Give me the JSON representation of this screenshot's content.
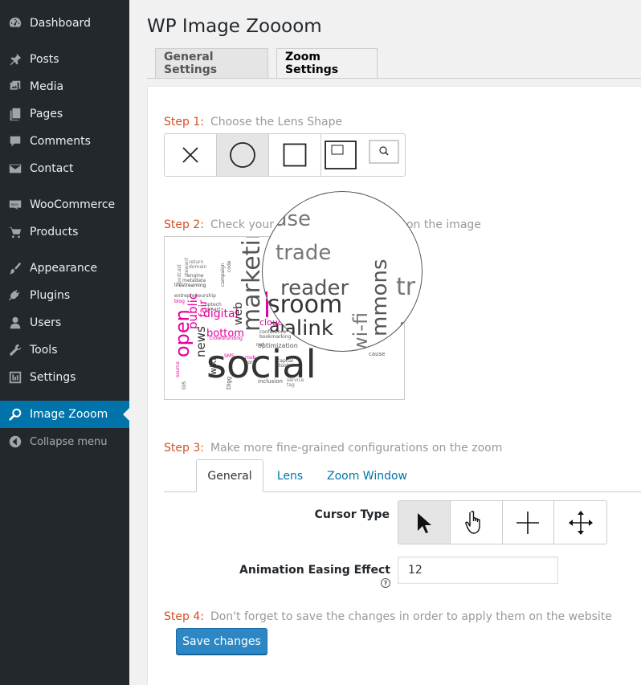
{
  "sidebar": {
    "items": [
      {
        "label": "Dashboard",
        "icon": "dashboard-icon"
      },
      {
        "label": "Posts",
        "icon": "pin-icon"
      },
      {
        "label": "Media",
        "icon": "media-icon"
      },
      {
        "label": "Pages",
        "icon": "pages-icon"
      },
      {
        "label": "Comments",
        "icon": "comment-icon"
      },
      {
        "label": "Contact",
        "icon": "envelope-icon"
      },
      {
        "label": "WooCommerce",
        "icon": "woo-icon"
      },
      {
        "label": "Products",
        "icon": "cart-icon"
      },
      {
        "label": "Appearance",
        "icon": "brush-icon"
      },
      {
        "label": "Plugins",
        "icon": "plug-icon"
      },
      {
        "label": "Users",
        "icon": "user-icon"
      },
      {
        "label": "Tools",
        "icon": "wrench-icon"
      },
      {
        "label": "Settings",
        "icon": "sliders-icon"
      },
      {
        "label": "Image Zooom",
        "icon": "magnifier-icon"
      }
    ],
    "collapse_label": "Collapse menu",
    "active_color": "#0073aa",
    "background": "#23282d"
  },
  "page": {
    "title": "WP Image Zoooom",
    "tabs": [
      {
        "label": "General Settings",
        "active": false
      },
      {
        "label": "Zoom Settings",
        "active": true
      }
    ]
  },
  "steps": {
    "step1": {
      "num": "Step 1:",
      "text": "Choose the Lens Shape"
    },
    "step2": {
      "num": "Step 2:",
      "text": "Check your configuration changes on the image"
    },
    "step3": {
      "num": "Step 3:",
      "text": "Make more fine-grained configurations on the zoom"
    },
    "step4": {
      "num": "Step 4:",
      "text": "Don't forget to save the changes in order to apply them on the website"
    }
  },
  "lens_shapes": [
    "none-icon",
    "circle-icon",
    "square-icon",
    "square-window-icon"
  ],
  "lens_shape_selected": 1,
  "demo": {
    "words": [
      "social",
      "marketing",
      "open",
      "newsroom",
      "alink",
      "trade",
      "reader",
      "commons",
      "wi-fi",
      "digital",
      "bottom",
      "public",
      "fair",
      "news",
      "web",
      "cloud",
      "wiki",
      "Digg",
      "optimization",
      "inclusion",
      "entrepreneurship",
      "lifestreaming",
      "engine",
      "metadata",
      "return",
      "domain",
      "podcast",
      "steward",
      "campaign",
      "code",
      "crowdfunding",
      "smart",
      "nptech",
      "service",
      "tag",
      "tools",
      "capital",
      "corp",
      "cause",
      "mob",
      "SMS",
      "conference",
      "bookmarking",
      "net",
      "blog",
      "source",
      "GIS"
    ],
    "lens_words": [
      "use",
      "trade",
      "reader",
      "sroom",
      "alink",
      "mmons",
      "wi-fi",
      "tr",
      "gs"
    ]
  },
  "subtabs": [
    "General",
    "Lens",
    "Zoom Window"
  ],
  "fields": {
    "cursor_type_label": "Cursor Type",
    "cursor_types": [
      "arrow-cursor-icon",
      "hand-cursor-icon",
      "crosshair-cursor-icon",
      "move-cursor-icon"
    ],
    "cursor_selected": 0,
    "easing_label": "Animation Easing Effect",
    "easing_help": "?",
    "easing_value": "12"
  },
  "save_label": "Save changes",
  "colors": {
    "step_accent": "#d54e21",
    "link": "#0073aa",
    "button_primary": "#2e87c5",
    "word_magenta": "#e6009e"
  }
}
